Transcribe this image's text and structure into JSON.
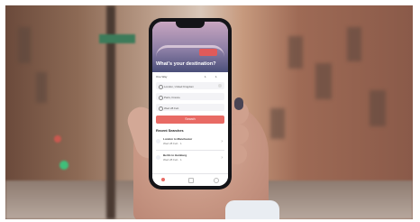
{
  "app": {
    "hero_title": "What's your destination?",
    "trip_type": "One Way",
    "passengers": "1",
    "bags": "1",
    "from_value": "London, United Kingdom",
    "to_value": "Paris, France",
    "date_value": "Wed 28 Feb",
    "search_label": "Search",
    "recent_title": "Recent Searches",
    "recent": [
      {
        "route": "London to Manchester",
        "subtitle": "Wed 28 Feb · 1"
      },
      {
        "route": "Berlin to Hamburg",
        "subtitle": "Wed 28 Feb · 1"
      }
    ]
  }
}
